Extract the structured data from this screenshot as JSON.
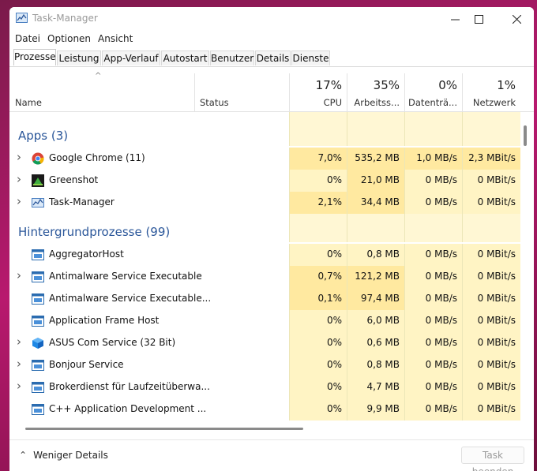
{
  "window": {
    "title": "Task-Manager"
  },
  "menu": [
    "Datei",
    "Optionen",
    "Ansicht"
  ],
  "tabs": [
    "Prozesse",
    "Leistung",
    "App-Verlauf",
    "Autostart",
    "Benutzer",
    "Details",
    "Dienste"
  ],
  "columns": {
    "name": "Name",
    "status": "Status",
    "cpu": {
      "pct": "17%",
      "label": "CPU"
    },
    "mem": {
      "pct": "35%",
      "label": "Arbeitss..."
    },
    "disk": {
      "pct": "0%",
      "label": "Datenträ..."
    },
    "net": {
      "pct": "1%",
      "label": "Netzwerk"
    }
  },
  "groups": {
    "apps": "Apps (3)",
    "background": "Hintergrundprozesse (99)"
  },
  "processes": [
    {
      "name": "Google Chrome (11)",
      "icon": "chrome-icon",
      "cpu": "7,0%",
      "mem": "535,2 MB",
      "disk": "1,0 MB/s",
      "net": "2,3 MBit/s"
    },
    {
      "name": "Greenshot",
      "icon": "greenshot-icon",
      "cpu": "0%",
      "mem": "21,0 MB",
      "disk": "0 MB/s",
      "net": "0 MBit/s"
    },
    {
      "name": "Task-Manager",
      "icon": "task-manager-icon",
      "cpu": "2,1%",
      "mem": "34,4 MB",
      "disk": "0 MB/s",
      "net": "0 MBit/s"
    },
    {
      "name": "AggregatorHost",
      "icon": "service-icon",
      "cpu": "0%",
      "mem": "0,8 MB",
      "disk": "0 MB/s",
      "net": "0 MBit/s"
    },
    {
      "name": "Antimalware Service Executable",
      "icon": "service-icon",
      "cpu": "0,7%",
      "mem": "121,2 MB",
      "disk": "0 MB/s",
      "net": "0 MBit/s"
    },
    {
      "name": "Antimalware Service Executable...",
      "icon": "service-icon",
      "cpu": "0,1%",
      "mem": "97,4 MB",
      "disk": "0 MB/s",
      "net": "0 MBit/s"
    },
    {
      "name": "Application Frame Host",
      "icon": "service-icon",
      "cpu": "0%",
      "mem": "6,0 MB",
      "disk": "0 MB/s",
      "net": "0 MBit/s"
    },
    {
      "name": "ASUS Com Service (32 Bit)",
      "icon": "asus-cube-icon",
      "cpu": "0%",
      "mem": "0,6 MB",
      "disk": "0 MB/s",
      "net": "0 MBit/s"
    },
    {
      "name": "Bonjour Service",
      "icon": "service-icon",
      "cpu": "0%",
      "mem": "0,8 MB",
      "disk": "0 MB/s",
      "net": "0 MBit/s"
    },
    {
      "name": "Brokerdienst für Laufzeitüberwa...",
      "icon": "service-icon",
      "cpu": "0%",
      "mem": "4,7 MB",
      "disk": "0 MB/s",
      "net": "0 MBit/s"
    },
    {
      "name": "C++ Application Development ...",
      "icon": "service-icon",
      "cpu": "0%",
      "mem": "9,9 MB",
      "disk": "0 MB/s",
      "net": "0 MBit/s"
    }
  ],
  "footer": {
    "less": "Weniger Details",
    "end_task": "Task beenden"
  },
  "colors": {
    "group": "#2b579a",
    "heat_low": "#fff4c4",
    "heat_mid": "#ffeea8",
    "heat_high": "#ffe58a"
  }
}
